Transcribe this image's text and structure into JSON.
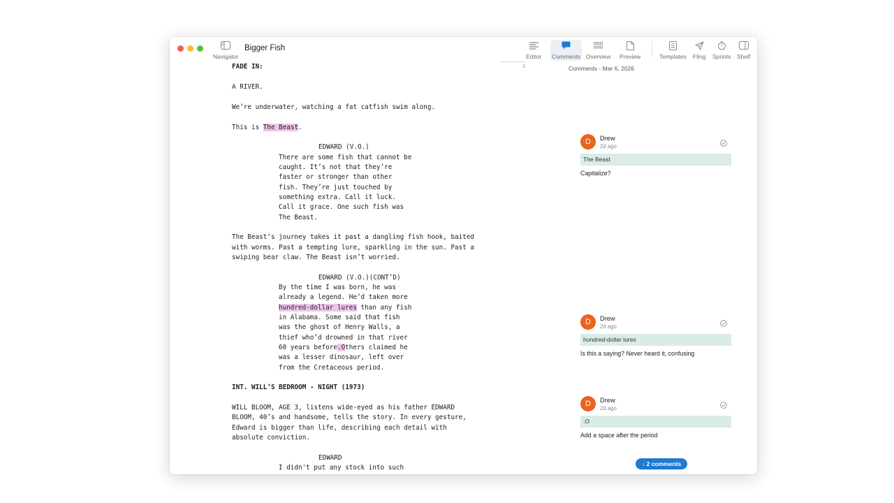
{
  "window": {
    "title": "Bigger Fish"
  },
  "toolbar": {
    "navigator": "Navigator",
    "editor": "Editor",
    "comments": "Comments",
    "overview": "Overview",
    "preview": "Preview",
    "templates": "Templates",
    "fling": "Fling",
    "sprints": "Sprints",
    "shelf": "Shelf"
  },
  "page": {
    "number": "1"
  },
  "script_lines": [
    {
      "text": "FADE IN:",
      "style": "transition"
    },
    {
      "text": "A RIVER.",
      "style": "action"
    },
    {
      "text": "We’re underwater, watching a fat catfish swim along.",
      "style": "action"
    },
    {
      "pre": "This is ",
      "hl": "The Beast",
      "post": ".",
      "style": "action"
    },
    {
      "text": "EDWARD (V.O.)",
      "style": "character"
    },
    {
      "text": "There are some fish that cannot be",
      "style": "dialogue"
    },
    {
      "text": "caught. It’s not that they’re",
      "style": "dialogue"
    },
    {
      "text": "faster or stronger than other",
      "style": "dialogue"
    },
    {
      "text": "fish. They’re just touched by",
      "style": "dialogue"
    },
    {
      "text": "something extra. Call it luck.",
      "style": "dialogue"
    },
    {
      "text": "Call it grace. One such fish was",
      "style": "dialogue"
    },
    {
      "text": "The Beast.",
      "style": "dialogue"
    },
    {
      "text": "The Beast’s journey takes it past a dangling fish hook, baited",
      "style": "action"
    },
    {
      "text": "with worms. Past a tempting lure, sparkling in the sun. Past a",
      "style": "action"
    },
    {
      "text": "swiping bear claw. The Beast isn’t worried.",
      "style": "action"
    },
    {
      "text": "EDWARD (V.O.)(CONT’D)",
      "style": "character"
    },
    {
      "text": "By the time I was born, he was",
      "style": "dialogue"
    },
    {
      "text": "already a legend. He’d taken more",
      "style": "dialogue"
    },
    {
      "pre": "",
      "hl": "hundred-dollar lures",
      "post": " than any fish",
      "style": "dialogue"
    },
    {
      "text": "in Alabama. Some said that fish",
      "style": "dialogue"
    },
    {
      "text": "was the ghost of Henry Walls, a",
      "style": "dialogue"
    },
    {
      "text": "thief who’d drowned in that river",
      "style": "dialogue"
    },
    {
      "pre": "60 years before",
      "hl": ".O",
      "post": "thers claimed he",
      "style": "dialogue"
    },
    {
      "text": "was a lesser dinosaur, left over",
      "style": "dialogue"
    },
    {
      "text": "from the Cretaceous period.",
      "style": "dialogue"
    },
    {
      "text": "INT. WILL’S BEDROOM - NIGHT (1973)",
      "style": "scene"
    },
    {
      "text": "WILL BLOOM, AGE 3, listens wide-eyed as his father EDWARD",
      "style": "action"
    },
    {
      "text": "BLOOM, 40’s and handsome, tells the story. In every gesture,",
      "style": "action"
    },
    {
      "text": "Edward is bigger than life, describing each detail with",
      "style": "action"
    },
    {
      "text": "absolute conviction.",
      "style": "action"
    },
    {
      "text": "EDWARD",
      "style": "character"
    },
    {
      "text": "I didn't put any stock into such",
      "style": "dialogue"
    }
  ],
  "comments_panel": {
    "header": "Comments - Mar 6, 2026",
    "comments": [
      {
        "avatar": "D",
        "author": "Drew",
        "time": "2d ago",
        "quote": "The Beast",
        "text": "Capitalize?"
      },
      {
        "avatar": "D",
        "author": "Drew",
        "time": "2d ago",
        "quote": "hundred-dollar lures",
        "text": "Is this a saying? Never heard it, confusing"
      },
      {
        "avatar": "D",
        "author": "Drew",
        "time": "2d ago",
        "quote": ".O",
        "text": "Add a space after the period"
      }
    ],
    "more_button": "↓ 2 comments"
  }
}
